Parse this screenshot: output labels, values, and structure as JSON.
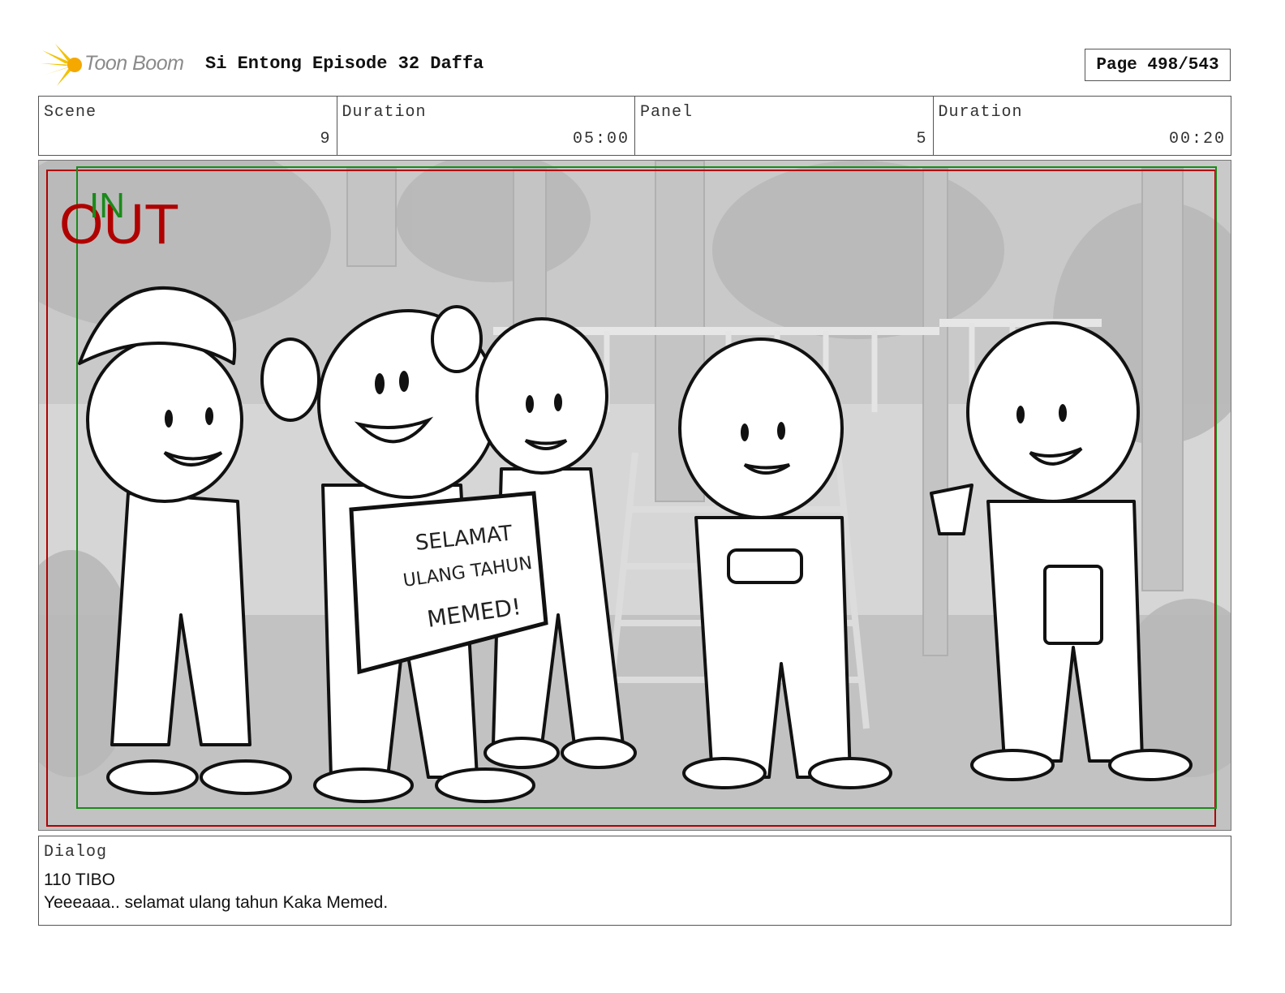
{
  "header": {
    "logo_text": "Toon Boom",
    "title": "Si Entong Episode 32 Daffa",
    "page_label": "Page 498/543"
  },
  "info": [
    {
      "label": "Scene",
      "value": "9"
    },
    {
      "label": "Duration",
      "value": "05:00"
    },
    {
      "label": "Panel",
      "value": "5"
    },
    {
      "label": "Duration",
      "value": "00:20"
    }
  ],
  "panel": {
    "overlay_out": "OUT",
    "overlay_in": "IN",
    "sign_line1": "SELAMAT",
    "sign_line2": "ULANG TAHUN",
    "sign_line3": "MEMED!",
    "frame_colors": {
      "out": "#b00000",
      "in": "#1a8a1a"
    }
  },
  "dialog": {
    "label": "Dialog",
    "line1": "110 TIBO",
    "line2": "Yeeeaaa.. selamat ulang tahun Kaka Memed."
  }
}
